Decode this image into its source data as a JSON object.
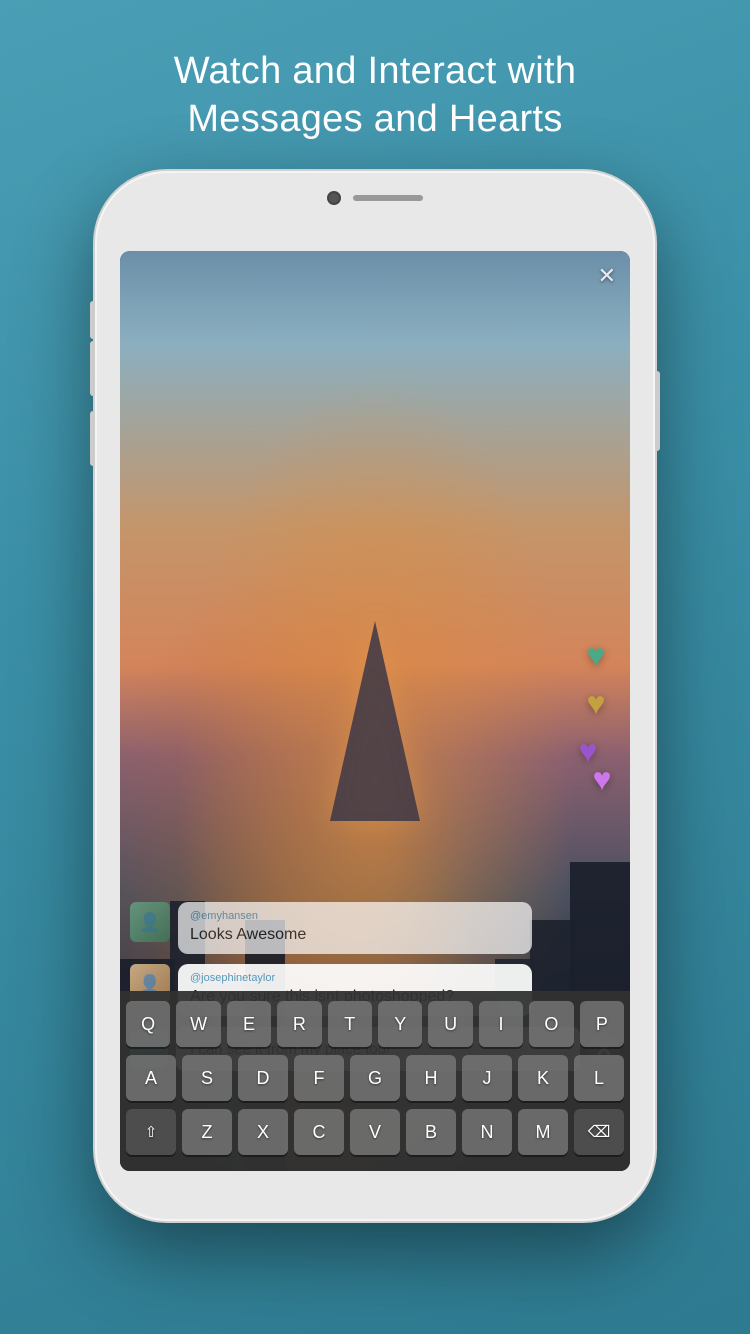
{
  "header": {
    "title": "Watch and Interact with\nMessages and Hearts"
  },
  "phone": {
    "close_btn": "✕",
    "hearts": [
      {
        "color": "#4aaa88",
        "glyph": "♥",
        "id": "green-heart"
      },
      {
        "color": "#c4a040",
        "glyph": "♥",
        "id": "gold-heart"
      },
      {
        "color": "#9955cc",
        "glyph": "♥",
        "id": "purple-heart-1"
      },
      {
        "color": "#bb66dd",
        "glyph": "♥",
        "id": "purple-heart-2"
      }
    ],
    "messages": [
      {
        "id": "msg-1",
        "username": "@emyhansen",
        "text": "Looks Awesome",
        "faded": true
      },
      {
        "id": "msg-2",
        "username": "@josephinetaylor",
        "text": "Are you sure this isnt photoshopped?",
        "faded": false
      }
    ],
    "input": {
      "value": "I can see it from my place too!",
      "clear_icon": "✕"
    },
    "keyboard": {
      "rows": [
        [
          "Q",
          "W",
          "E",
          "R",
          "T",
          "Y",
          "U",
          "I",
          "O",
          "P"
        ],
        [
          "A",
          "S",
          "D",
          "F",
          "G",
          "H",
          "J",
          "K",
          "L"
        ],
        [
          "⇧",
          "Z",
          "X",
          "C",
          "V",
          "B",
          "N",
          "M",
          "⌫"
        ]
      ]
    }
  }
}
